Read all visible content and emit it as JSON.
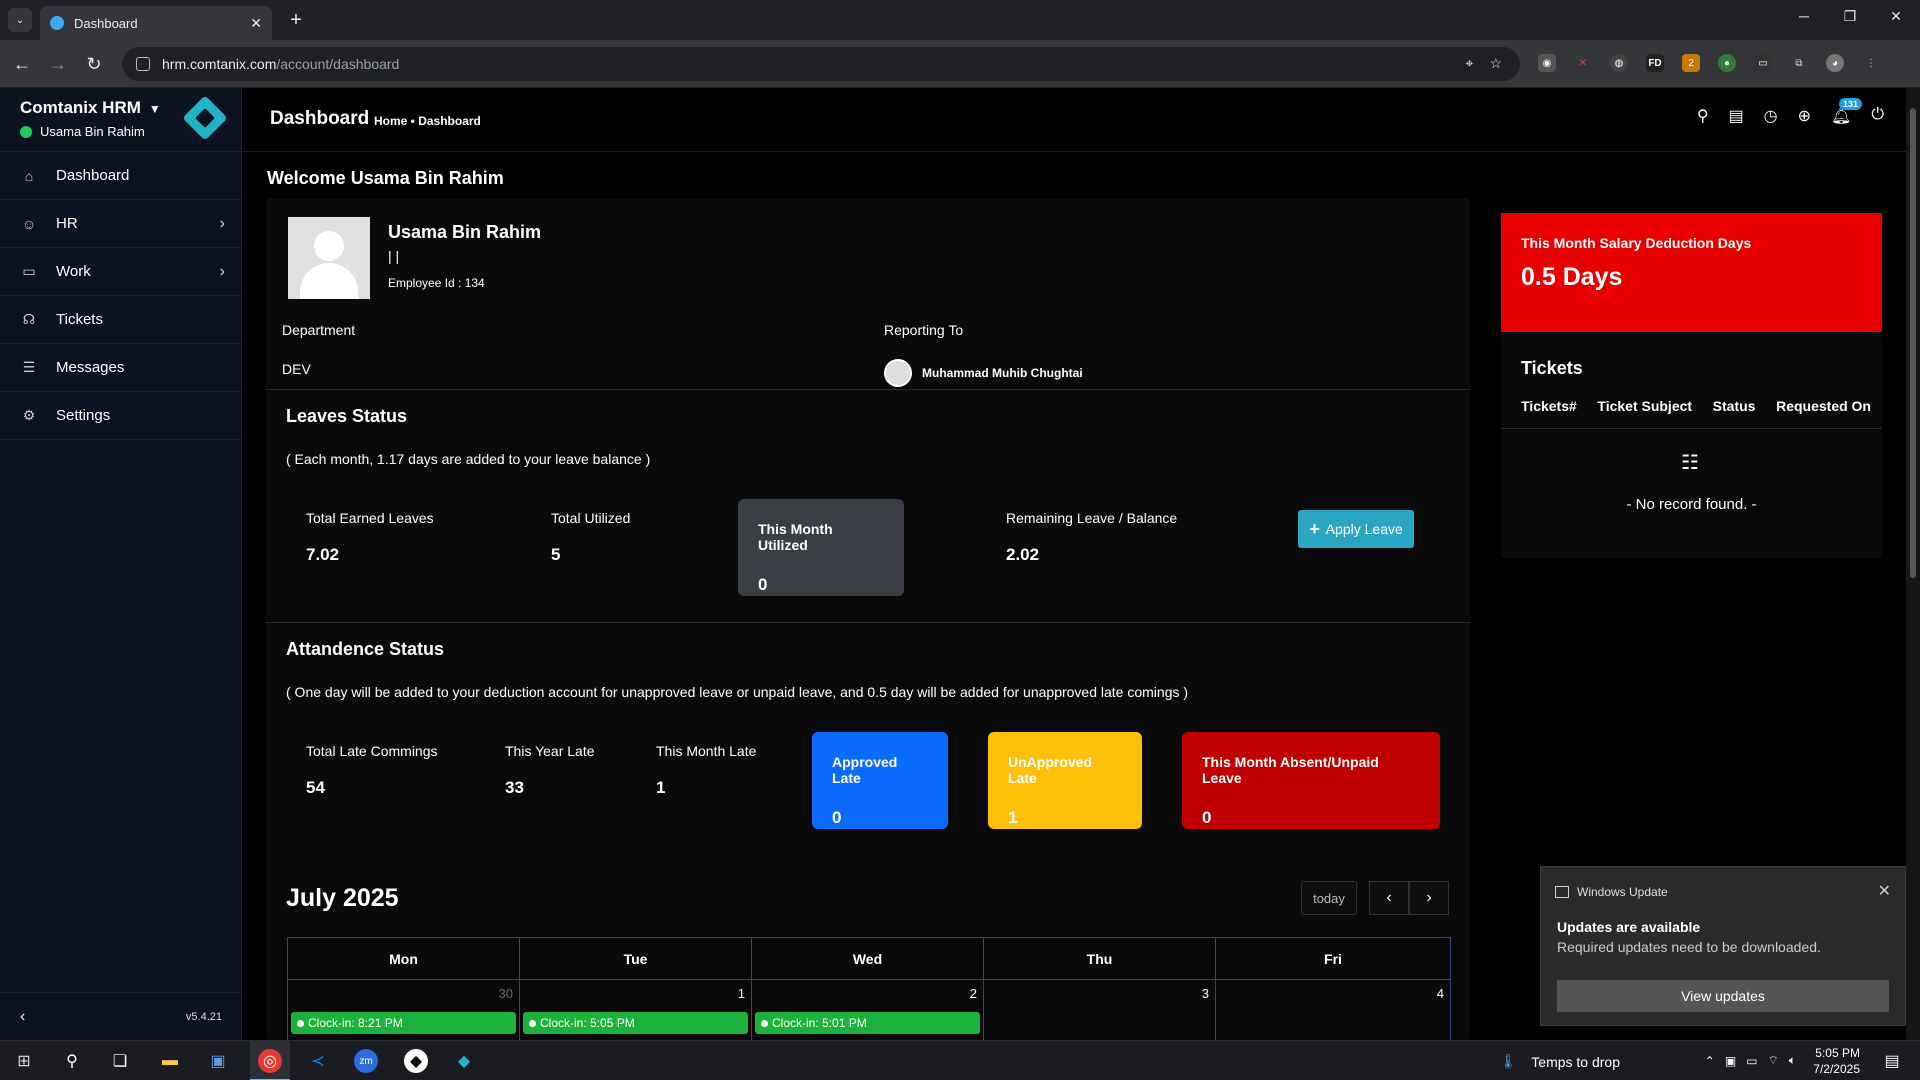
{
  "browser": {
    "tab_title": "Dashboard",
    "url_host": "hrm.comtanix.com",
    "url_path": "/account/dashboard"
  },
  "sidebar": {
    "brand": "Comtanix HRM",
    "user": "Usama Bin Rahim",
    "items": [
      {
        "label": "Dashboard",
        "icon": "home-icon"
      },
      {
        "label": "HR",
        "icon": "users-icon"
      },
      {
        "label": "Work",
        "icon": "briefcase-icon"
      },
      {
        "label": "Tickets",
        "icon": "headset-icon"
      },
      {
        "label": "Messages",
        "icon": "message-icon"
      },
      {
        "label": "Settings",
        "icon": "gear-icon"
      }
    ],
    "version": "v5.4.21"
  },
  "topbar": {
    "title": "Dashboard",
    "breadcrumb": "Home • Dashboard",
    "notification_count": "131"
  },
  "welcome": "Welcome Usama Bin Rahim",
  "profile": {
    "name": "Usama Bin Rahim",
    "separator": "| |",
    "employee_id": "Employee Id : 134",
    "department_label": "Department",
    "department": "DEV",
    "reporting_label": "Reporting To",
    "reporting_to": "Muhammad Muhib Chughtai"
  },
  "leaves": {
    "title": "Leaves Status",
    "note": "( Each month, 1.17 days are added to your leave balance )",
    "earned_label": "Total Earned Leaves",
    "earned": "7.02",
    "utilized_label": "Total Utilized",
    "utilized": "5",
    "month_label": "This Month Utilized",
    "month": "0",
    "remaining_label": "Remaining Leave / Balance",
    "remaining": "2.02",
    "apply_button": "Apply Leave"
  },
  "attendance": {
    "title": "Attandence Status",
    "note": "( One day will be added to your deduction account for unapproved leave or unpaid leave, and 0.5 day will be added for unapproved late comings )",
    "late_label": "Total Late Commings",
    "late": "54",
    "year_label": "This Year Late",
    "year": "33",
    "month_label": "This Month Late",
    "month": "1",
    "approved_label": "Approved Late",
    "approved": "0",
    "unapproved_label": "UnApproved Late",
    "unapproved": "1",
    "absent_label": "This Month Absent/Unpaid Leave",
    "absent": "0"
  },
  "calendar": {
    "title": "July 2025",
    "today": "today",
    "days": [
      "Mon",
      "Tue",
      "Wed",
      "Thu",
      "Fri"
    ],
    "dates": [
      "30",
      "1",
      "2",
      "3",
      "4"
    ],
    "events": [
      "Clock-in: 8:21 PM",
      "Clock-in: 5:05 PM",
      "Clock-in: 5:01 PM"
    ]
  },
  "salary": {
    "label": "This Month Salary Deduction Days",
    "value": "0.5 Days"
  },
  "tickets": {
    "title": "Tickets",
    "columns": [
      "Tickets#",
      "Ticket Subject",
      "Status",
      "Requested On"
    ],
    "empty": "- No record found. -"
  },
  "toast": {
    "app": "Windows Update",
    "title": "Updates are available",
    "body": "Required updates need to be downloaded.",
    "button": "View updates"
  },
  "taskbar": {
    "weather": "Temps to drop",
    "time": "5:05 PM",
    "date": "7/2/2025"
  }
}
